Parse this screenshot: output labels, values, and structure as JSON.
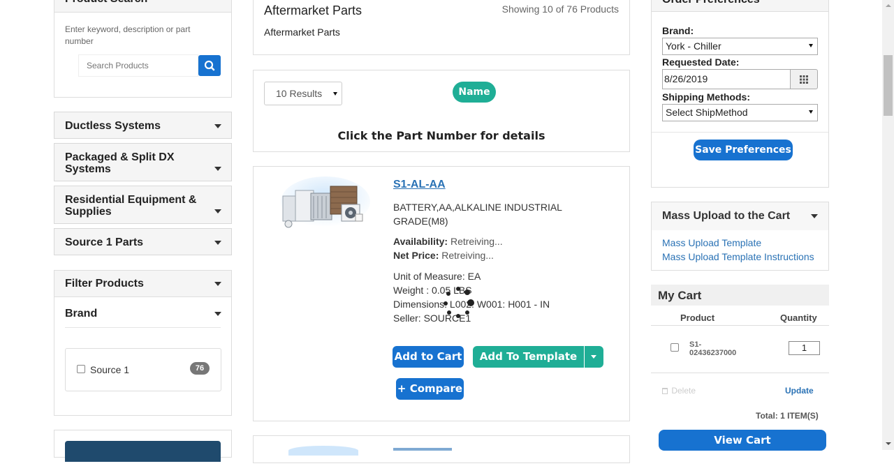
{
  "left": {
    "product_search": {
      "title": "Product Search",
      "hint": "Enter keyword, description or part number",
      "placeholder": "Search Products"
    },
    "categories": [
      {
        "label": "Ductless Systems"
      },
      {
        "label": "Packaged & Split DX Systems"
      },
      {
        "label": "Residential Equipment & Supplies"
      },
      {
        "label": "Source 1 Parts"
      }
    ],
    "filter": {
      "title": "Filter Products",
      "brand_title": "Brand",
      "brand_option": "Source 1",
      "brand_count": "76"
    }
  },
  "main": {
    "header": {
      "title": "Aftermarket Parts",
      "showing": "Showing 10 of 76 Products",
      "subtitle": "Aftermarket Parts"
    },
    "toolbar": {
      "results_select": "10 Results",
      "sort_label": "Name",
      "instruction": "Click the Part Number for details"
    },
    "product": {
      "part_number": "S1-AL-AA",
      "description": "BATTERY,AA,ALKALINE INDUSTRIAL GRADE(M8)",
      "availability_label": "Availability:",
      "availability_value": "Retreiving...",
      "net_price_label": "Net Price:",
      "net_price_value": "Retreiving...",
      "uom": "Unit of Measure: EA",
      "weight": "Weight : 0.05 LBS",
      "dimensions": "Dimensions: L002: W001: H001 - IN",
      "seller": "Seller: SOURCE1",
      "add_to_cart": "Add to Cart",
      "add_to_template": "Add To Template",
      "compare": "+ Compare"
    }
  },
  "right": {
    "order_prefs": {
      "title": "Order Preferences",
      "brand_label": "Brand:",
      "brand_value": "York - Chiller",
      "date_label": "Requested Date:",
      "date_value": "8/26/2019",
      "ship_label": "Shipping Methods:",
      "ship_value": "Select ShipMethod",
      "save": "Save Preferences"
    },
    "mass_upload": {
      "title": "Mass Upload to the Cart",
      "link1": "Mass Upload Template",
      "link2": "Mass Upload Template Instructions"
    },
    "cart": {
      "title": "My Cart",
      "col_product": "Product",
      "col_qty": "Quantity",
      "item_code_1": "S1-",
      "item_code_2": "02436237000",
      "item_qty": "1",
      "delete": "Delete",
      "update": "Update",
      "total": "Total: 1 ITEM(S)",
      "view_cart": "View Cart"
    }
  },
  "colors": {
    "primary_blue": "#1772d0",
    "teal": "#1fae96",
    "link": "#2a72b5",
    "navy": "#1f4a6d"
  }
}
